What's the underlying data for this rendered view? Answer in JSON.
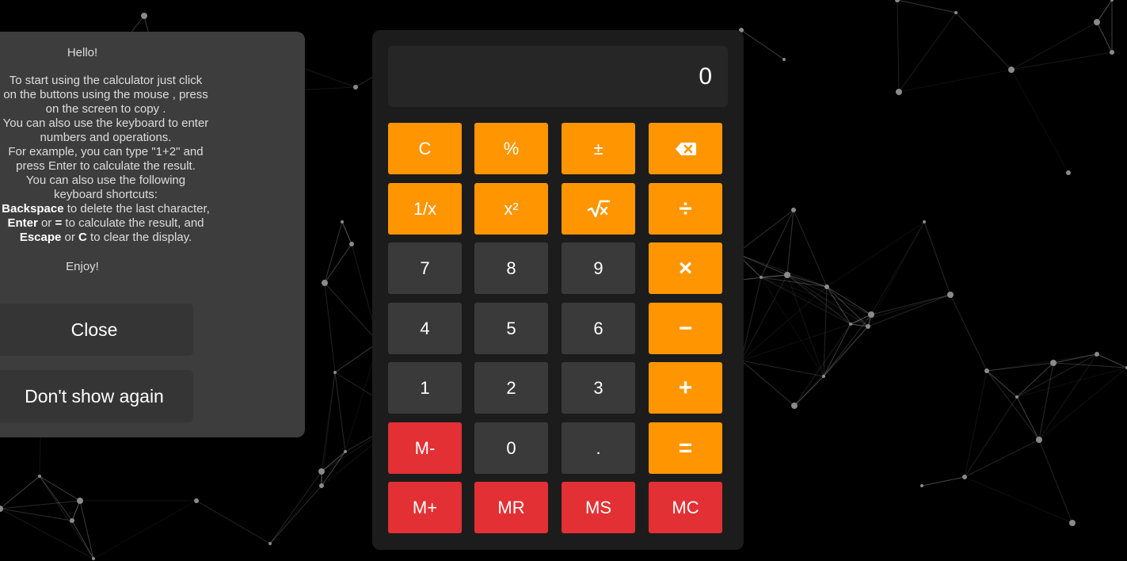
{
  "help": {
    "title": "Hello!",
    "lines": [
      "To start using the calculator just click",
      "on the buttons using the mouse , press",
      "on the screen to copy .",
      "You can also use the keyboard to enter",
      "numbers and operations.",
      "For example, you can type \"1+2\" and",
      "press Enter to calculate the result.",
      "You can also use the following",
      "keyboard shortcuts:"
    ],
    "shortcuts": [
      {
        "key": "Backspace",
        "text": " to delete the last character,"
      },
      {
        "key": "Enter",
        "mid": " or ",
        "key2": "=",
        "text": " to calculate the result, and"
      },
      {
        "key": "Escape",
        "mid": " or ",
        "key2": "C",
        "text": " to clear the display."
      }
    ],
    "enjoy": "Enjoy!",
    "close_label": "Close",
    "dont_show_label": "Don't show again"
  },
  "display": {
    "value": "0"
  },
  "keys": {
    "clear": "C",
    "percent": "%",
    "plusminus": "±",
    "reciprocal": "1/x",
    "square": "x²",
    "divide": "÷",
    "seven": "7",
    "eight": "8",
    "nine": "9",
    "multiply": "×",
    "four": "4",
    "five": "5",
    "six": "6",
    "minus": "−",
    "one": "1",
    "two": "2",
    "three": "3",
    "plus": "+",
    "mminus": "M-",
    "zero": "0",
    "dot": ".",
    "equals": "=",
    "mplus": "M+",
    "mrecall": "MR",
    "mstore": "MS",
    "mclear": "MC"
  },
  "icons": {
    "backspace": "backspace-icon",
    "sqrt": "square-root-icon"
  },
  "colors": {
    "operator": "#ff9500",
    "digit": "#3a3a3a",
    "memory": "#e23034",
    "panel": "#1c1c1c",
    "modal": "#3d3d3d"
  }
}
